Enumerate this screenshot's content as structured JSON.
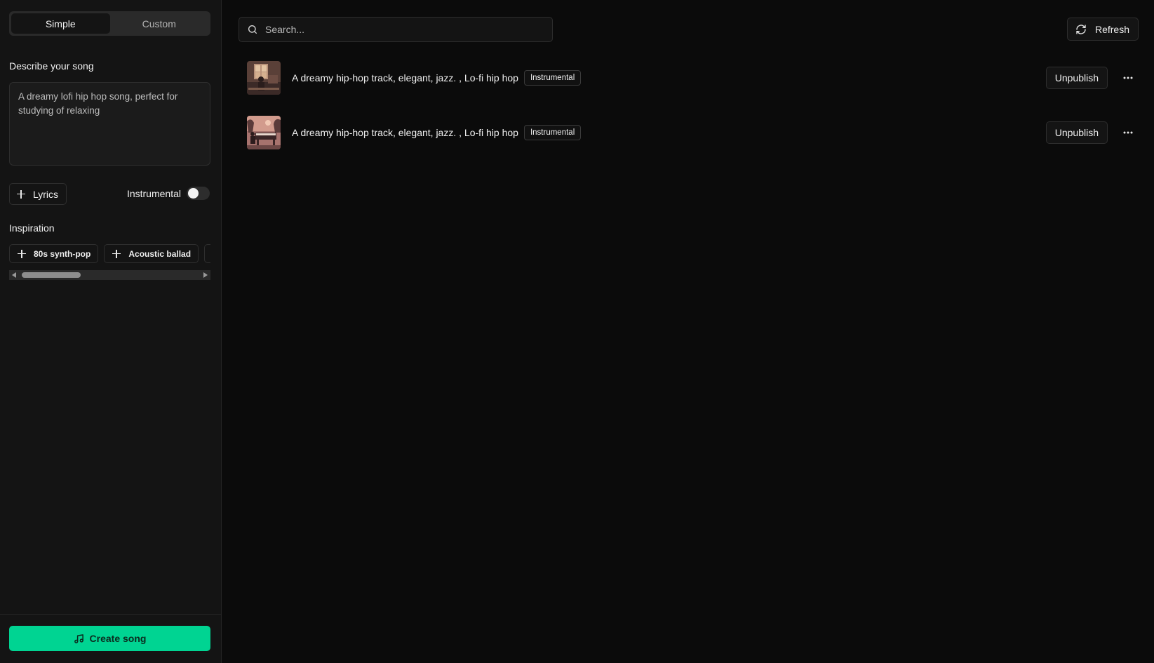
{
  "sidebar": {
    "mode_tabs": [
      {
        "label": "Simple",
        "active": true
      },
      {
        "label": "Custom",
        "active": false
      }
    ],
    "describe_label": "Describe your song",
    "prompt_value": "A dreamy lofi hip hop song, perfect for studying of relaxing",
    "lyrics_label": "Lyrics",
    "instrumental_label": "Instrumental",
    "instrumental_on": false,
    "inspiration_label": "Inspiration",
    "inspiration_chips": [
      "80s synth-pop",
      "Acoustic ballad",
      ""
    ],
    "create_label": "Create song",
    "accent_color": "#00d492"
  },
  "main": {
    "search_placeholder": "Search...",
    "refresh_label": "Refresh",
    "songs": [
      {
        "title": "A dreamy hip-hop track, elegant, jazz. , Lo-fi hip hop",
        "badge": "Instrumental",
        "action_label": "Unpublish",
        "cover_icon": "cover-art-window-icon"
      },
      {
        "title": "A dreamy hip-hop track, elegant, jazz. , Lo-fi hip hop",
        "badge": "Instrumental",
        "action_label": "Unpublish",
        "cover_icon": "cover-art-piano-icon"
      }
    ]
  }
}
